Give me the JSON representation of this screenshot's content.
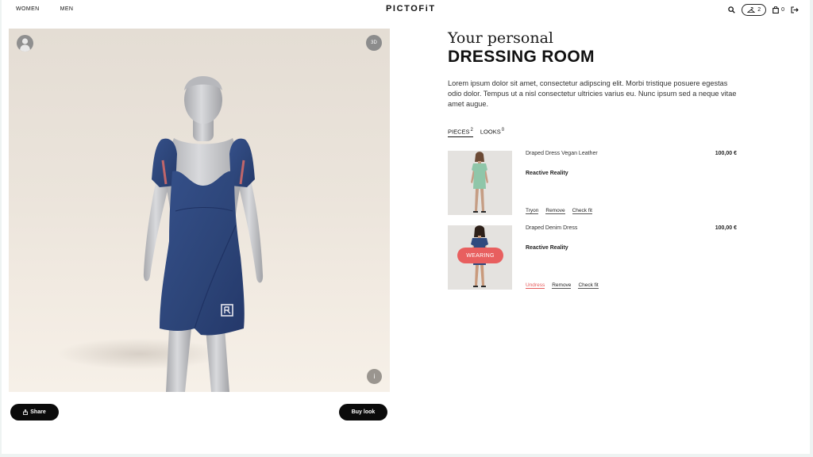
{
  "nav": {
    "women": "WOMEN",
    "men": "MEN",
    "logo": "PICTOFiT",
    "user_count": "2",
    "cart_count": "0"
  },
  "viewer": {
    "rotate_label": "3D",
    "info_label": "i",
    "share_label": "Share",
    "buy_label": "Buy look"
  },
  "panel": {
    "title_line1": "Your personal",
    "title_line2": "DRESSING ROOM",
    "intro": "Lorem ipsum dolor sit amet, consectetur adipscing elit. Morbi tristique posuere egestas odio dolor. Tempus ut a nisl consectetur ultricies varius eu. Nunc ipsum sed a neque vitae amet augue.",
    "tabs": [
      {
        "label": "PIECES",
        "count": "2"
      },
      {
        "label": "LOOKS",
        "count": "0"
      }
    ],
    "items": [
      {
        "name": "Draped Dress Vegan Leather",
        "price": "100,00 €",
        "brand": "Reactive Reality",
        "actions": [
          "Tryon",
          "Remove",
          "Check fit"
        ]
      },
      {
        "name": "Draped Denim Dress",
        "price": "100,00 €",
        "brand": "Reactive Reality",
        "badge": "WEARING",
        "actions": [
          "Undress",
          "Remove",
          "Check fit"
        ]
      }
    ]
  },
  "colors": {
    "accent": "#e85f5f",
    "dress_denim": "#2f4a7e",
    "dress_green": "#8fc6a9",
    "button_dark": "#0b0b0b"
  }
}
